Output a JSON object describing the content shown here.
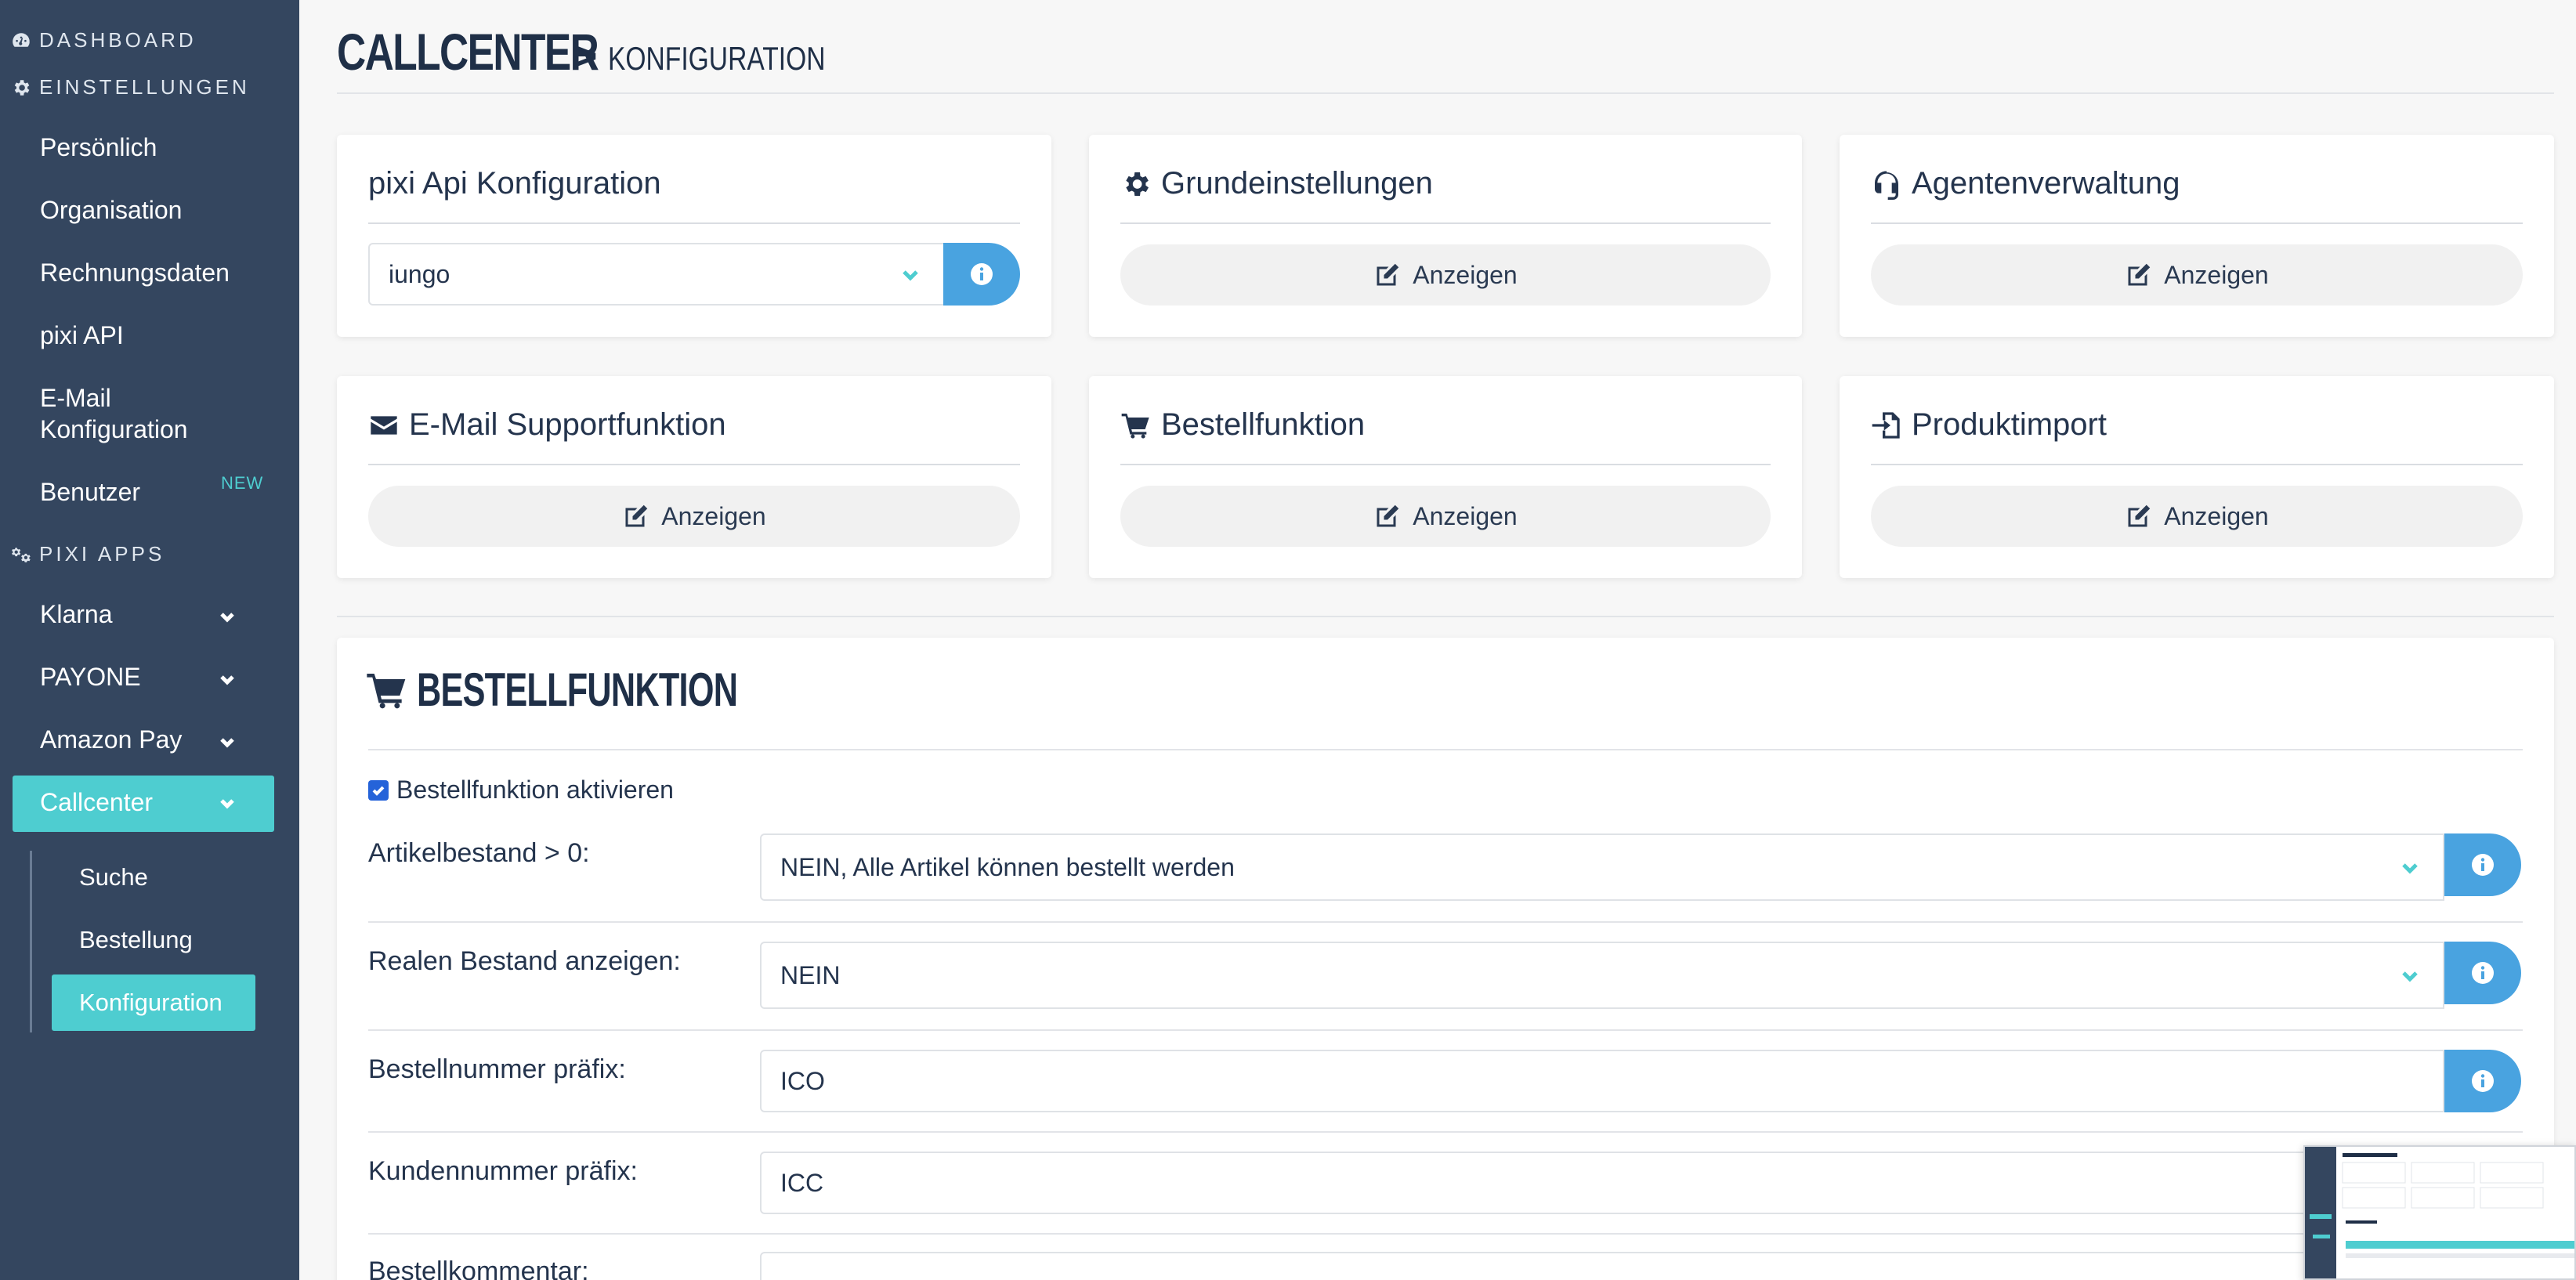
{
  "sidebar": {
    "dashboard": "DASHBOARD",
    "einstellungen": "EINSTELLUNGEN",
    "items": [
      "Persönlich",
      "Organisation",
      "Rechnungsdaten",
      "pixi API",
      "E-Mail",
      "Konfiguration",
      "Benutzer"
    ],
    "benutzer_badge": "NEW",
    "pixi_apps": "PIXI APPS",
    "apps": [
      "Klarna",
      "PAYONE",
      "Amazon Pay",
      "Callcenter"
    ],
    "sub": [
      "Suche",
      "Bestellung",
      "Konfiguration"
    ]
  },
  "header": {
    "title_main": "CALLCENTER",
    "sep": ">",
    "title_sub": "KONFIGURATION"
  },
  "cards": {
    "api": {
      "title": "pixi Api Konfiguration",
      "select_value": "iungo"
    },
    "grund": {
      "title": "Grundeinstellungen",
      "button": "Anzeigen"
    },
    "agent": {
      "title": "Agentenverwaltung",
      "button": "Anzeigen"
    },
    "email": {
      "title": "E-Mail Supportfunktion",
      "button": "Anzeigen"
    },
    "bestell": {
      "title": "Bestellfunktion",
      "button": "Anzeigen"
    },
    "produkt": {
      "title": "Produktimport",
      "button": "Anzeigen"
    }
  },
  "bestellfunktion": {
    "title": "BESTELLFUNKTION",
    "checkbox_label": "Bestellfunktion aktivieren",
    "checkbox_checked": true,
    "rows": [
      {
        "label": "Artikelbestand > 0:",
        "value": "NEIN, Alle Artikel können bestellt werden"
      },
      {
        "label": "Realen Bestand anzeigen:",
        "value": "NEIN"
      },
      {
        "label": "Bestellnummer präfix:",
        "value": "ICO"
      },
      {
        "label": "Kundennummer präfix:",
        "value": "ICC"
      },
      {
        "label": "Bestellkommentar:",
        "value": ""
      }
    ]
  },
  "colors": {
    "sidebar_bg": "#34465f",
    "accent": "#4ecdd0",
    "info": "#49a3e0",
    "title": "#1f2f47"
  }
}
